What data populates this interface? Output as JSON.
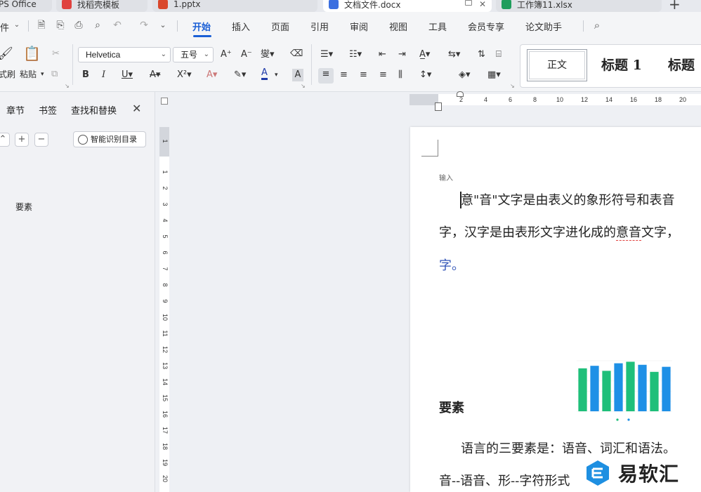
{
  "tabs": [
    {
      "label": "PS Office",
      "color": "#e7e9ee"
    },
    {
      "label": "找稻壳模板",
      "color": "#e0423f"
    },
    {
      "label": "1.pptx",
      "color": "#d9472b"
    },
    {
      "label": "文档文件.docx",
      "color": "#3b6fe0"
    },
    {
      "label": "工作簿11.xlsx",
      "color": "#1f9d5c"
    }
  ],
  "menubar": {
    "file_label": "件",
    "items": [
      "开始",
      "插入",
      "页面",
      "引用",
      "审阅",
      "视图",
      "工具",
      "会员专享",
      "论文助手"
    ],
    "active": "开始"
  },
  "ribbon": {
    "format_painter": "式刷",
    "paste": "粘贴",
    "font_name": "Helvetica",
    "font_size": "五号",
    "styles": {
      "normal": "正文",
      "heading1": "标题 1",
      "heading2": "标题"
    }
  },
  "navpane": {
    "tabs": [
      "章节",
      "书签",
      "查找和替换"
    ],
    "smart_toc": "智能识别目录",
    "entries": [
      "要素"
    ]
  },
  "hruler_ticks": [
    "2",
    "4",
    "6",
    "8",
    "10",
    "12",
    "14",
    "16",
    "18",
    "20"
  ],
  "vruler_ticks": [
    "1",
    "1",
    "2",
    "3",
    "4",
    "5",
    "6",
    "7",
    "8",
    "9",
    "10",
    "11",
    "12",
    "13",
    "14",
    "15",
    "16",
    "17",
    "18",
    "19",
    "20"
  ],
  "document": {
    "input_label": "输入",
    "line1": "意\"音\"文字是由表义的象形符号和表音",
    "line2_a": "字，汉字是由表形文字进化成的",
    "line2_b": "意音",
    "line2_c": "文字，",
    "line3": "字。",
    "heading": "要素",
    "para2_line1": "语言的三要素是：语音、词汇和语法。",
    "para2_line2": "音--语音、形--字符形式"
  },
  "chart_data": {
    "type": "bar",
    "categories": [
      "",
      "",
      "",
      "",
      "",
      "",
      "",
      "",
      "",
      ""
    ],
    "series": [
      {
        "values": [
          85,
          90,
          80,
          95,
          98,
          92,
          78,
          88,
          0,
          0
        ]
      }
    ],
    "colors": [
      "#1fbf7a",
      "#1e90e6"
    ]
  },
  "watermark": {
    "text": "易软汇",
    "color": "#1e8fe1"
  }
}
